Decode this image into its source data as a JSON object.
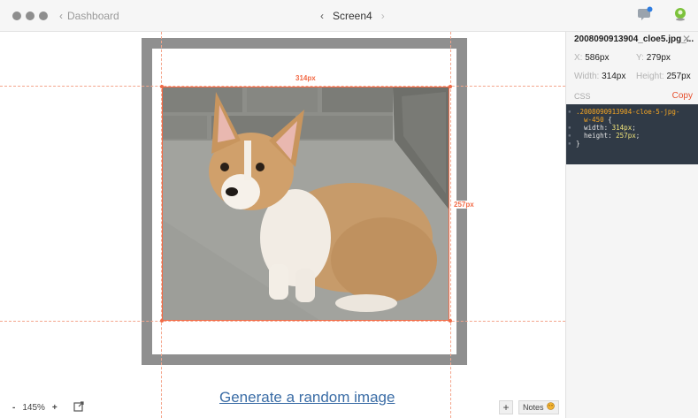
{
  "window": {
    "back_label": "Dashboard",
    "screen_title": "Screen4"
  },
  "icons": {
    "back": "chevron-left-icon",
    "prev": "chevron-left-icon",
    "next": "chevron-right-icon",
    "comments": "comment-bubble-icon",
    "profile": "avatar-icon",
    "close": "close-icon",
    "external": "external-link-icon",
    "notes": "notes-emoji-icon"
  },
  "canvas": {
    "width_label": "314px",
    "height_label": "257px",
    "link_text": "Generate a random image",
    "image_alt": "Corgi puppy sitting on concrete"
  },
  "footer": {
    "zoom_minus": "-",
    "zoom_level": "145%",
    "zoom_plus": "+",
    "add_label": "+",
    "notes_label": "Notes"
  },
  "inspector": {
    "title": "2008090913904_cloe5.jpg_...",
    "x_key": "X:",
    "x_val": "586px",
    "y_key": "Y:",
    "y_val": "279px",
    "w_key": "Width:",
    "w_val": "314px",
    "h_key": "Height:",
    "h_val": "257px",
    "css_label": "CSS",
    "copy_label": "Copy",
    "code_selector_1": ".2008090913904-cloe-5-jpg-",
    "code_selector_2": "w-450",
    "code_brace_open": " {",
    "code_prop_1": "width",
    "code_val_1": "314px",
    "code_prop_2": "height",
    "code_val_2": "257px",
    "code_brace_close": "}"
  },
  "colors": {
    "accent": "#f26a46",
    "link": "#3b6da6",
    "frame": "#8f8f8f",
    "code_bg": "#303a46"
  }
}
